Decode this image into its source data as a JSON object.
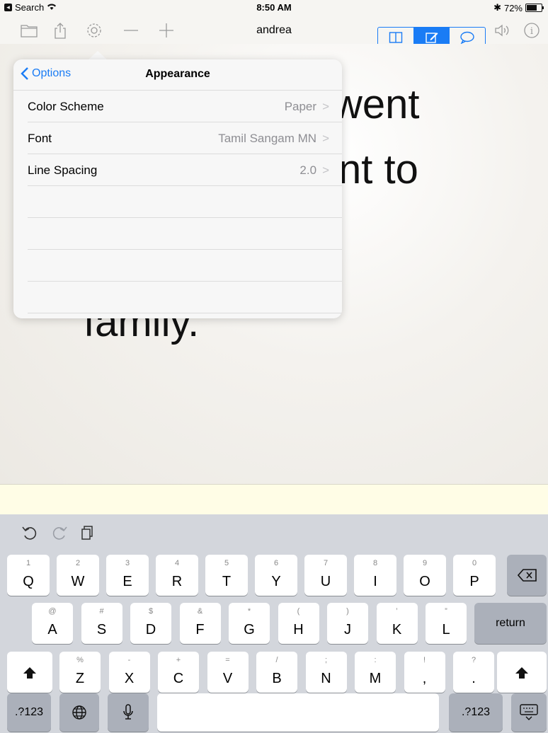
{
  "status": {
    "back_app": "Search",
    "time": "8:50 AM",
    "battery": "72%",
    "battery_level": 0.72
  },
  "toolbar": {
    "title": "andrea"
  },
  "document": {
    "line1": "went",
    "line2": "nt to",
    "line3": "family."
  },
  "popover": {
    "back_label": "Options",
    "title": "Appearance",
    "rows": [
      {
        "label": "Color Scheme",
        "value": "Paper"
      },
      {
        "label": "Font",
        "value": "Tamil Sangam MN"
      },
      {
        "label": "Line Spacing",
        "value": "2.0"
      }
    ]
  },
  "keyboard": {
    "row1": [
      {
        "sub": "1",
        "main": "Q"
      },
      {
        "sub": "2",
        "main": "W"
      },
      {
        "sub": "3",
        "main": "E"
      },
      {
        "sub": "4",
        "main": "R"
      },
      {
        "sub": "5",
        "main": "T"
      },
      {
        "sub": "6",
        "main": "Y"
      },
      {
        "sub": "7",
        "main": "U"
      },
      {
        "sub": "8",
        "main": "I"
      },
      {
        "sub": "9",
        "main": "O"
      },
      {
        "sub": "0",
        "main": "P"
      }
    ],
    "row2": [
      {
        "sub": "@",
        "main": "A"
      },
      {
        "sub": "#",
        "main": "S"
      },
      {
        "sub": "$",
        "main": "D"
      },
      {
        "sub": "&",
        "main": "F"
      },
      {
        "sub": "*",
        "main": "G"
      },
      {
        "sub": "(",
        "main": "H"
      },
      {
        "sub": ")",
        "main": "J"
      },
      {
        "sub": "’",
        "main": "K"
      },
      {
        "sub": "”",
        "main": "L"
      }
    ],
    "row3": [
      {
        "sub": "%",
        "main": "Z"
      },
      {
        "sub": "-",
        "main": "X"
      },
      {
        "sub": "+",
        "main": "C"
      },
      {
        "sub": "=",
        "main": "V"
      },
      {
        "sub": "/",
        "main": "B"
      },
      {
        "sub": ";",
        "main": "N"
      },
      {
        "sub": ":",
        "main": "M"
      },
      {
        "sub": "!",
        "main": ","
      },
      {
        "sub": "?",
        "main": "."
      }
    ],
    "return_label": "return",
    "numbers_label": ".?123"
  }
}
